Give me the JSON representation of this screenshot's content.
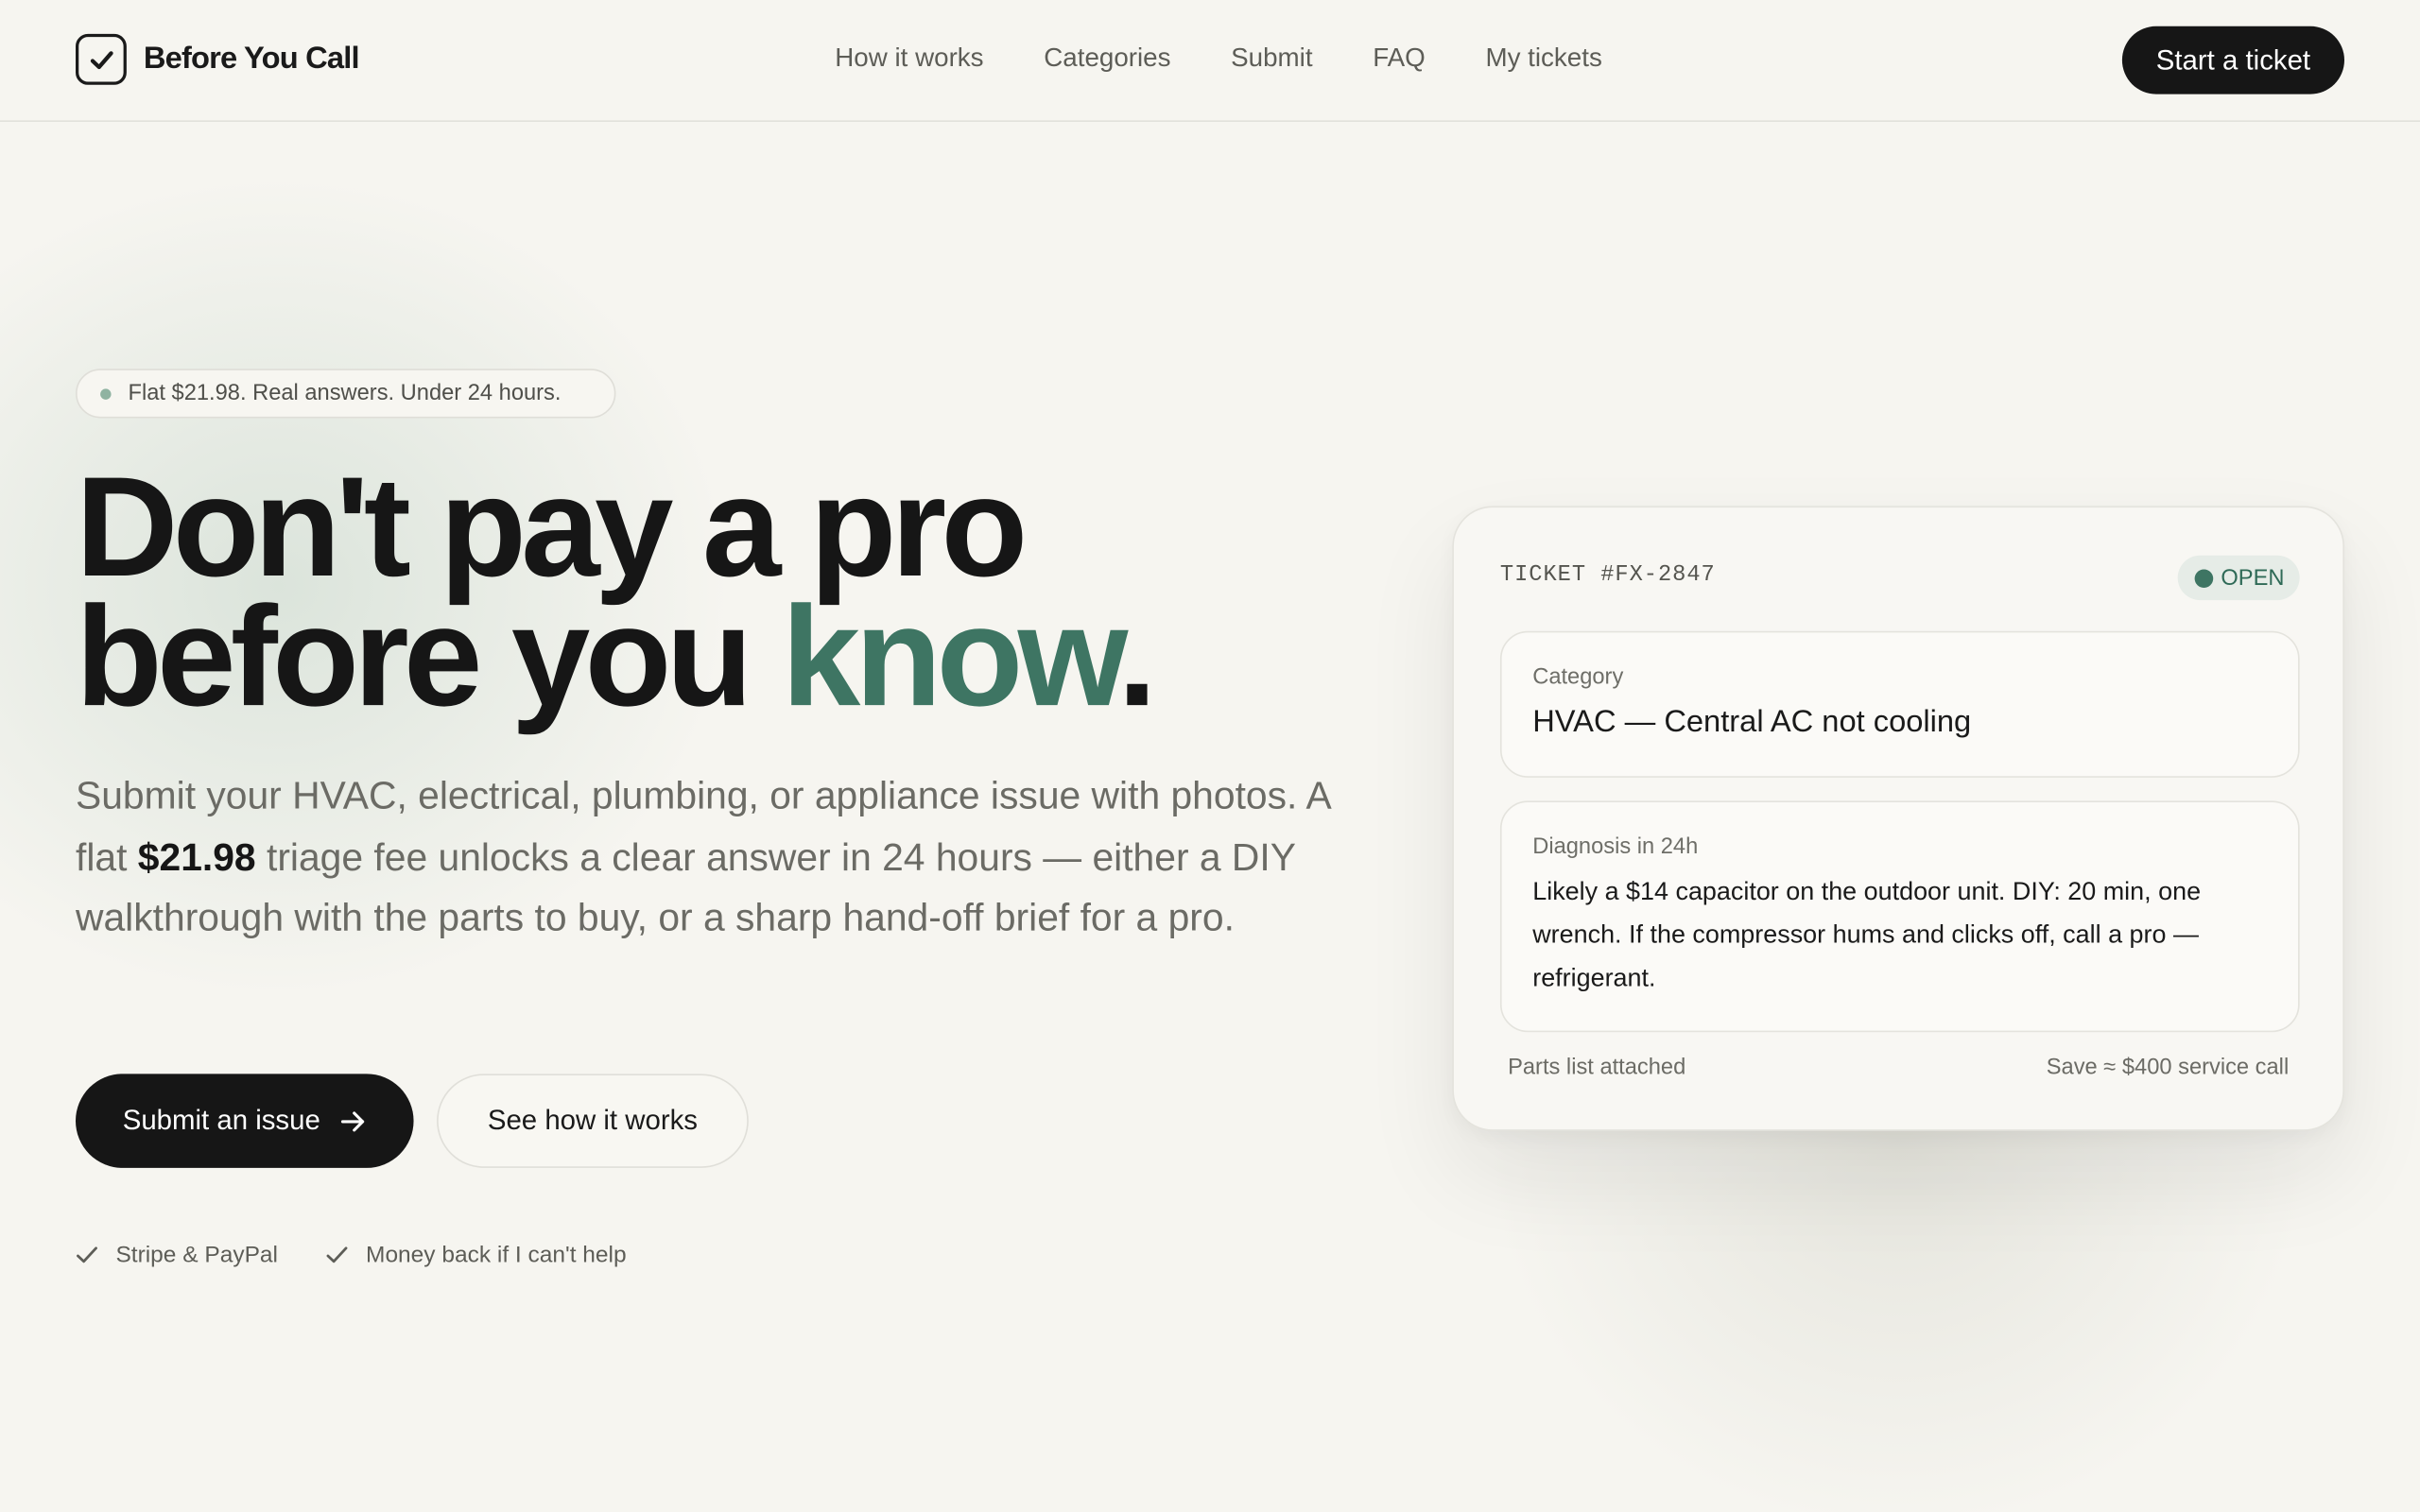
{
  "brand": {
    "name": "Before You Call",
    "icon": "check-square-icon"
  },
  "nav": {
    "links": [
      "How it works",
      "Categories",
      "Submit",
      "FAQ",
      "My tickets"
    ],
    "cta": "Start a ticket"
  },
  "hero": {
    "pill": "Flat $21.98. Real answers. Under 24 hours.",
    "headline_line1": "Don't pay a pro",
    "headline_line2_a": "before you ",
    "headline_line2_accent": "know",
    "headline_line2_end": ".",
    "sub_a": "Submit your HVAC, electrical, plumbing, or appliance issue with photos. A flat ",
    "sub_price": "$21.98",
    "sub_b": " triage fee unlocks a clear answer in 24 hours — either a DIY walkthrough with the parts to buy, or a sharp hand-off brief for a pro.",
    "primary_button": "Submit an issue",
    "secondary_button": "See how it works",
    "trust": [
      "Stripe & PayPal",
      "Money back if I can't help"
    ]
  },
  "ticket": {
    "id": "TICKET #FX-2847",
    "status": "OPEN",
    "category_label": "Category",
    "category_value": "HVAC — Central AC not cooling",
    "diagnosis_label": "Diagnosis in 24h",
    "diagnosis_value": "Likely a $14 capacitor on the outdoor unit. DIY: 20 min, one wrench. If the compressor hums and clicks off, call a pro — refrigerant.",
    "footer_left": "Parts list attached",
    "footer_right": "Save ≈ $400 service call"
  },
  "colors": {
    "background": "#f6f5f0",
    "accent": "#3e7563",
    "dark": "#161616"
  }
}
